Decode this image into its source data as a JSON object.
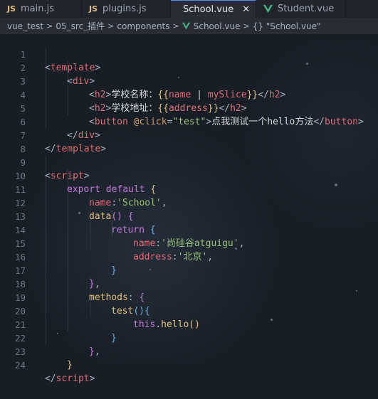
{
  "tabs": [
    {
      "label": "main.js",
      "kind": "js"
    },
    {
      "label": "plugins.js",
      "kind": "js"
    },
    {
      "label": "School.vue",
      "kind": "vue",
      "active": true
    },
    {
      "label": "Student.vue",
      "kind": "vue"
    }
  ],
  "tab_close_glyph": "✕",
  "js_badge": "JS",
  "breadcrumb": {
    "items": [
      "vue_test",
      "05_src_插件",
      "components",
      "School.vue",
      "{} \"School.vue\""
    ]
  },
  "line_numbers": [
    "1",
    "2",
    "3",
    "4",
    "5",
    "6",
    "7",
    "8",
    "9",
    "10",
    "11",
    "12",
    "13",
    "14",
    "15",
    "16",
    "17",
    "18",
    "19",
    "20",
    "21",
    "22",
    "23",
    "24"
  ],
  "code": {
    "l1": [
      "<",
      "template",
      ">"
    ],
    "l2": [
      "<",
      "div",
      ">"
    ],
    "l3": [
      "<",
      "h2",
      ">",
      "学校名称：",
      "{{",
      "name",
      " | ",
      "mySlice",
      "}}",
      "</",
      "h2",
      ">"
    ],
    "l4": [
      "<",
      "h2",
      ">",
      "学校地址：",
      "{{",
      "address",
      "}}",
      "</",
      "h2",
      ">"
    ],
    "l5": [
      "<",
      "button",
      " @click",
      "=",
      "\"test\"",
      ">",
      "点我测试一个hello方法",
      "</",
      "button",
      ">"
    ],
    "l6": [
      "</",
      "div",
      ">"
    ],
    "l7": [
      "</",
      "template",
      ">"
    ],
    "l9": [
      "<",
      "script",
      ">"
    ],
    "l10": [
      "export",
      " ",
      "default",
      " ",
      "{"
    ],
    "l11": [
      "name",
      ":",
      "'School'",
      ","
    ],
    "l12": [
      "data",
      "()",
      " ",
      "{"
    ],
    "l13": [
      "return",
      " ",
      "{"
    ],
    "l14": [
      "name",
      ":",
      "'尚硅谷atguigu'",
      ","
    ],
    "l15": [
      "address",
      ":",
      "'北京'",
      ","
    ],
    "l16": [
      "}"
    ],
    "l17": [
      "}",
      ","
    ],
    "l18": [
      "methods",
      ":",
      " ",
      "{"
    ],
    "l19": [
      "test",
      "(",
      ")",
      "{"
    ],
    "l20": [
      "this",
      ".",
      "hello",
      "(",
      ")"
    ],
    "l21": [
      "}"
    ],
    "l22": [
      "}",
      ","
    ],
    "l23": [
      "}"
    ],
    "l24": [
      "</",
      "script",
      ">"
    ]
  },
  "colors": {
    "background": "#181e26",
    "tag": "#e06c75",
    "string": "#98c379",
    "keyword": "#c678dd",
    "function": "#61afef",
    "mustache": "#e5c07b",
    "vue_logo": "#42b883"
  }
}
